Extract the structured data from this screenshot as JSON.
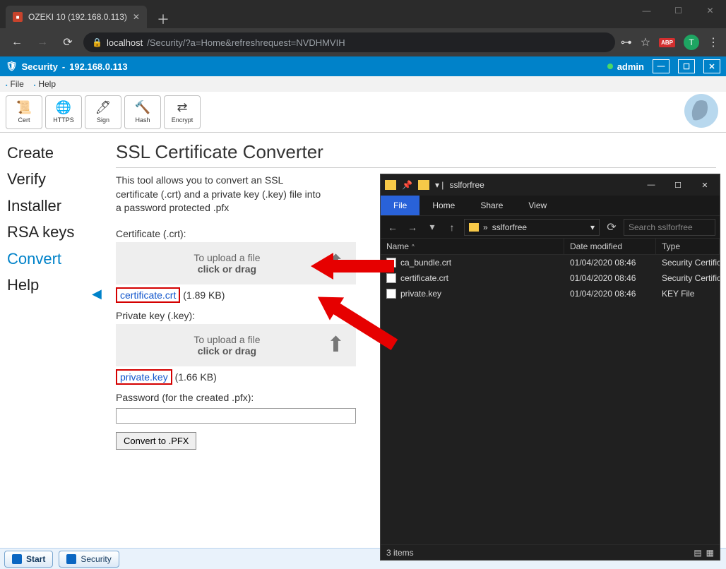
{
  "browser": {
    "tab_title": "OZEKI 10 (192.168.0.113)",
    "url_host": "localhost",
    "url_path": "/Security/?a=Home&refreshrequest=NVDHMVIH",
    "avatar_letter": "T"
  },
  "ozeki": {
    "title_app": "Security",
    "title_host": "192.168.0.113",
    "user": "admin",
    "menu": {
      "file": "File",
      "help": "Help"
    },
    "toolbar": [
      {
        "key": "cert",
        "label": "Cert",
        "icon": "📜"
      },
      {
        "key": "https",
        "label": "HTTPS",
        "icon": "🌐"
      },
      {
        "key": "sign",
        "label": "Sign",
        "icon": "🖊"
      },
      {
        "key": "hash",
        "label": "Hash",
        "icon": "🔨"
      },
      {
        "key": "encrypt",
        "label": "Encrypt",
        "icon": "⇄"
      }
    ],
    "sidenav": [
      "Create",
      "Verify",
      "Installer",
      "RSA keys",
      "Convert",
      "Help"
    ],
    "sidenav_active": "Convert"
  },
  "main": {
    "heading": "SSL Certificate Converter",
    "desc": "This tool allows you to convert an SSL certificate (.crt) and a private key (.key) file into a password protected .pfx",
    "cert_label": "Certificate (.crt):",
    "drop_line1": "To upload a file",
    "drop_line2": "click or drag",
    "cert_file": "certificate.crt",
    "cert_size": "(1.89 KB)",
    "key_label": "Private key (.key):",
    "key_file": "private.key",
    "key_size": "(1.66 KB)",
    "pw_label": "Password (for the created .pfx):",
    "pw_value": "",
    "convert_btn": "Convert to .PFX"
  },
  "taskbar": {
    "start": "Start",
    "security": "Security"
  },
  "explorer": {
    "folder": "sslforfree",
    "ribbon": [
      "File",
      "Home",
      "Share",
      "View"
    ],
    "ribbon_active": "File",
    "path_text": "sslforfree",
    "search_placeholder": "Search sslforfree",
    "cols": {
      "name": "Name",
      "date": "Date modified",
      "type": "Type"
    },
    "rows": [
      {
        "name": "ca_bundle.crt",
        "date": "01/04/2020 08:46",
        "type": "Security Certificate"
      },
      {
        "name": "certificate.crt",
        "date": "01/04/2020 08:46",
        "type": "Security Certificate"
      },
      {
        "name": "private.key",
        "date": "01/04/2020 08:46",
        "type": "KEY File"
      }
    ],
    "status": "3 items"
  }
}
